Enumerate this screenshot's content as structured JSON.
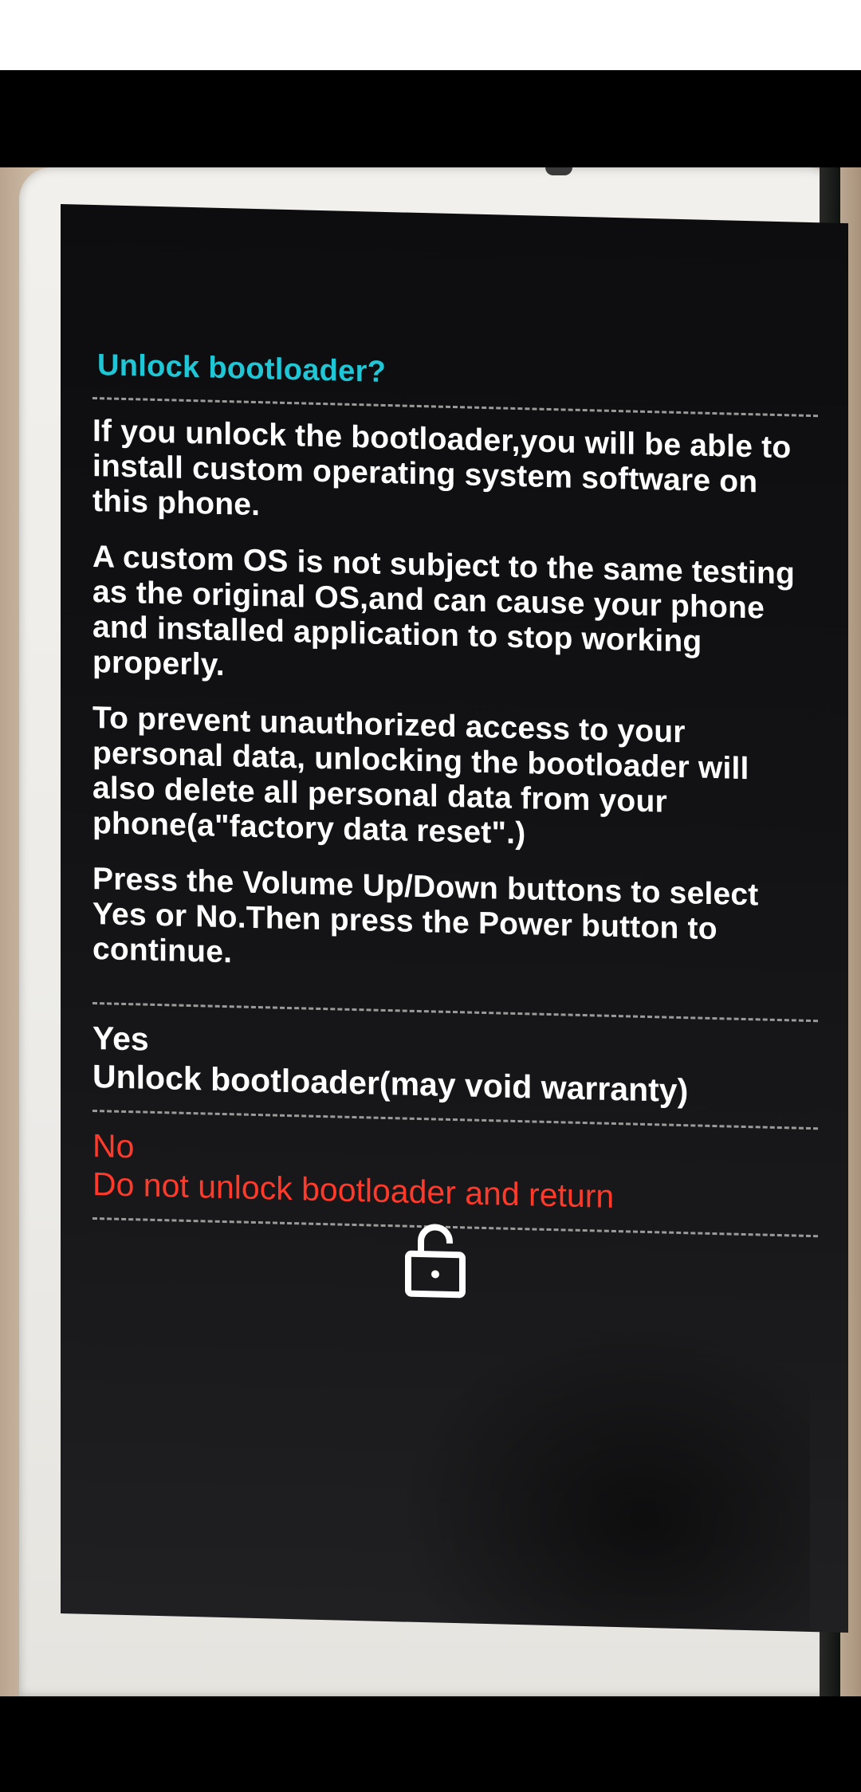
{
  "screen": {
    "title": "Unlock bootloader?",
    "paragraphs": [
      "If you unlock the bootloader,you will be able to install custom operating system software on this phone.",
      "A custom OS is not subject to the same testing as the original OS,and can cause your phone and installed application to stop working properly.",
      "To prevent unauthorized access to your personal data, unlocking the bootloader will also delete all  personal data from your phone(a\"factory data reset\".)",
      "Press the Volume Up/Down buttons to select Yes or No.Then press the Power button to continue."
    ],
    "options": [
      {
        "label": "Yes",
        "description": "Unlock bootloader(may void warranty)"
      },
      {
        "label": "No",
        "description": "Do not unlock bootloader and return"
      }
    ],
    "icon": "unlocked-padlock-icon"
  },
  "colors": {
    "title": "#1fc7d6",
    "body_text": "#ffffff",
    "no_option": "#ff3a2a",
    "screen_background": "#121214"
  }
}
